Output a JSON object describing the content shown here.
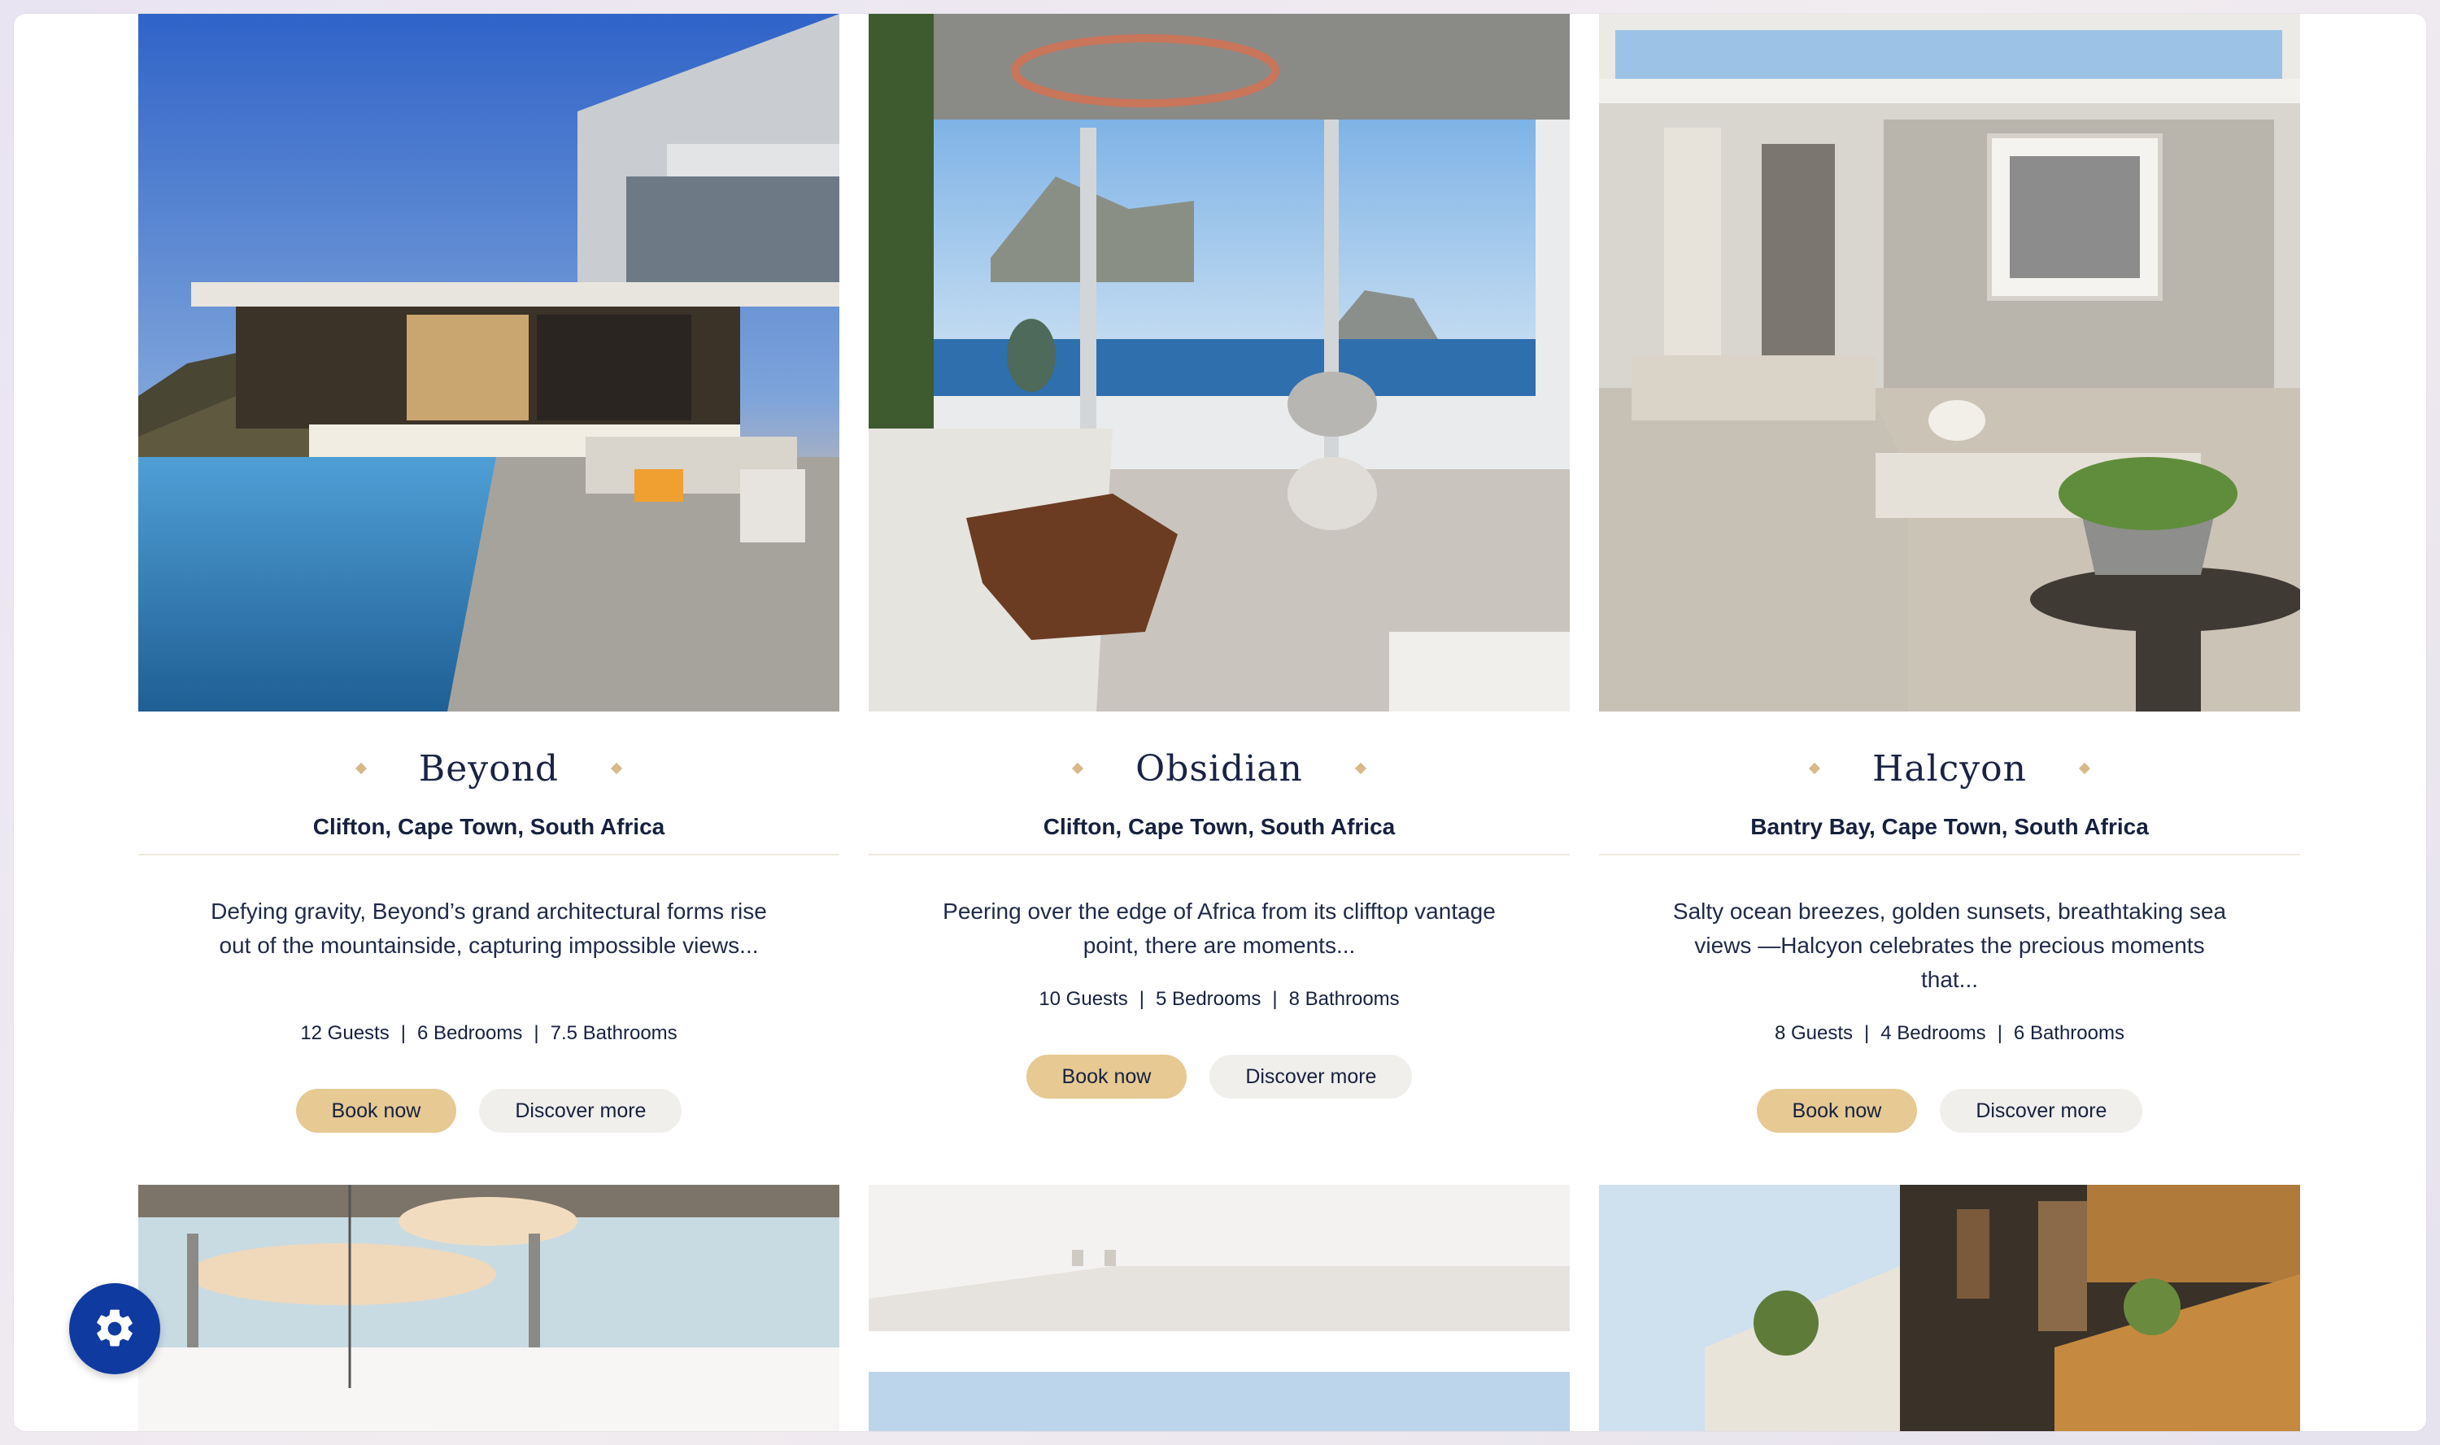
{
  "properties": [
    {
      "name": "Beyond",
      "location": "Clifton, Cape Town, South Africa",
      "description": "Defying gravity, Beyond’s grand architectural forms rise out of the mountainside, capturing impossible views...",
      "stats": {
        "guests": "12 Guests",
        "bedrooms": "6 Bedrooms",
        "bathrooms": "7.5 Bathrooms"
      },
      "book_label": "Book now",
      "discover_label": "Discover more"
    },
    {
      "name": "Obsidian",
      "location": "Clifton, Cape Town, South Africa",
      "description": "Peering over the edge of Africa from its clifftop vantage point, there are moments...",
      "stats": {
        "guests": "10 Guests",
        "bedrooms": "5 Bedrooms",
        "bathrooms": "8 Bathrooms"
      },
      "book_label": "Book now",
      "discover_label": "Discover more"
    },
    {
      "name": "Halcyon",
      "location": "Bantry Bay, Cape Town, South Africa",
      "description": "Salty ocean breezes, golden sunsets, breathtaking sea views —Halcyon celebrates the precious moments that...",
      "stats": {
        "guests": "8 Guests",
        "bedrooms": "4 Bedrooms",
        "bathrooms": "6 Bathrooms"
      },
      "book_label": "Book now",
      "discover_label": "Discover more"
    }
  ],
  "stat_separator": "|",
  "icons": {
    "settings": "gear-icon",
    "ornament": "diamond-ornament-icon"
  },
  "colors": {
    "accent_gold": "#e6c993",
    "ornament": "#d7b98a",
    "settings_button": "#0f3aa0",
    "text_navy": "#16213e"
  }
}
